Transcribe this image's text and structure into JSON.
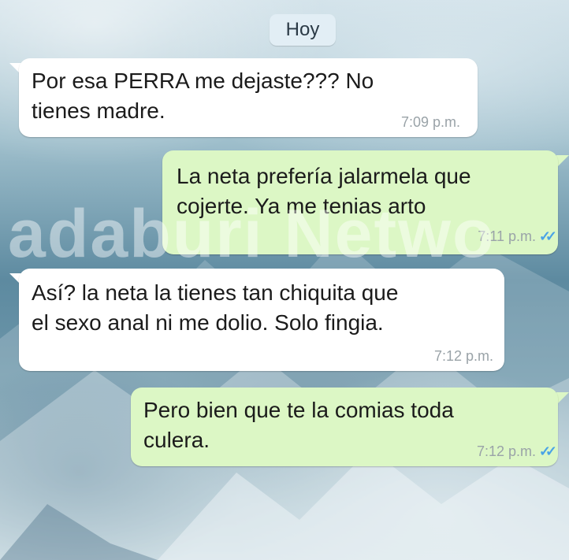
{
  "date_divider": "Hoy",
  "messages": [
    {
      "direction": "incoming",
      "text": "Por esa PERRA me dejaste??? No\ntienes madre.",
      "time": "7:09 p.m."
    },
    {
      "direction": "outgoing",
      "text": "La neta prefería jalarmela que\ncojerte. Ya me tenias arto",
      "time": "7:11 p.m.",
      "status": "read"
    },
    {
      "direction": "incoming",
      "text": "Así? la neta la tienes tan chiquita que\nel sexo anal ni me dolio. Solo fingia.",
      "time": "7:12 p.m."
    },
    {
      "direction": "outgoing",
      "text": "Pero bien que te la comias toda\nculera.",
      "time": "7:12 p.m.",
      "status": "read"
    }
  ],
  "watermark": "adaburi Netwo",
  "colors": {
    "incoming_bubble": "#ffffff",
    "outgoing_bubble": "#dcf7c5",
    "read_ticks": "#4aa3e6",
    "date_pill": "#e2eef5"
  },
  "icons": {
    "read_receipt": "double-check-icon"
  }
}
